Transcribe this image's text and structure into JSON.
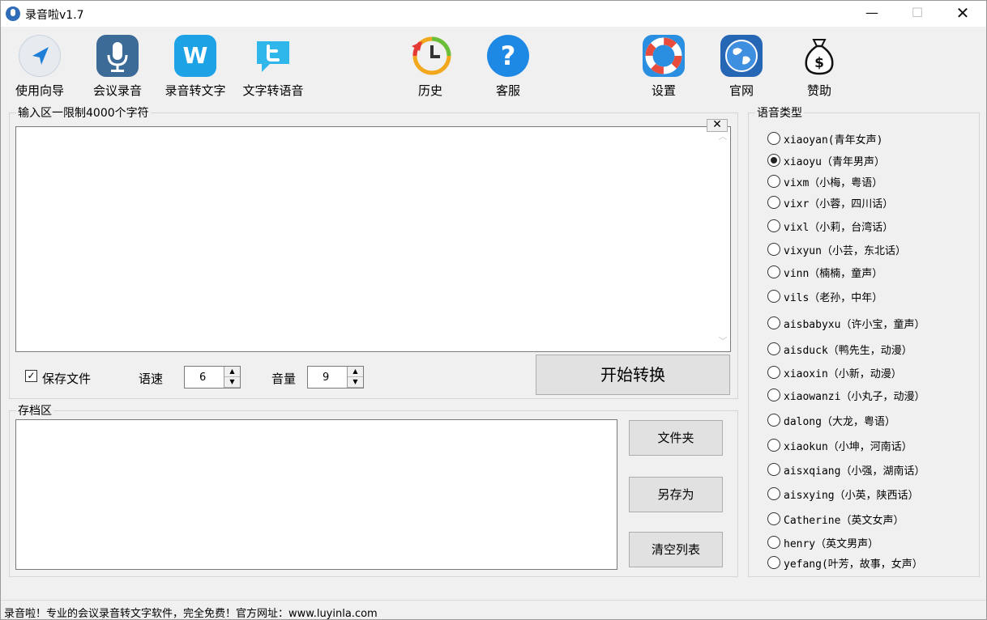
{
  "window": {
    "title": "录音啦v1.7",
    "controls": {
      "minimize": "—",
      "maximize": "☐",
      "close": "✕"
    }
  },
  "toolbar": [
    {
      "key": "guide",
      "label": "使用向导",
      "icon": "navigation-arrow-icon"
    },
    {
      "key": "meeting",
      "label": "会议录音",
      "icon": "microphone-icon"
    },
    {
      "key": "speech_to_text",
      "label": "录音转文字",
      "icon": "word-document-icon"
    },
    {
      "key": "text_to_speech",
      "label": "文字转语音",
      "icon": "bird-speech-icon"
    },
    {
      "key": "history",
      "label": "历史",
      "icon": "history-clock-icon"
    },
    {
      "key": "support",
      "label": "客服",
      "icon": "help-question-icon"
    },
    {
      "key": "settings",
      "label": "设置",
      "icon": "lifebuoy-icon"
    },
    {
      "key": "website",
      "label": "官网",
      "icon": "globe-icon"
    },
    {
      "key": "donate",
      "label": "赞助",
      "icon": "money-bag-icon"
    }
  ],
  "input_area": {
    "legend": "输入区一限制4000个字符",
    "text": "",
    "clear_button": "✕"
  },
  "options": {
    "save_file_label": "保存文件",
    "save_file_checked": true,
    "speed_label": "语速",
    "speed_value": "6",
    "volume_label": "音量",
    "volume_value": "9",
    "convert_button": "开始转换"
  },
  "archive_area": {
    "legend": "存档区",
    "items": [],
    "folder_button": "文件夹",
    "save_as_button": "另存为",
    "clear_list_button": "清空列表"
  },
  "voice_type": {
    "legend": "语音类型",
    "selected_index": 1,
    "options": [
      "xiaoyan(青年女声)",
      "xiaoyu（青年男声）",
      "vixm（小梅，粤语）",
      "vixr（小蓉，四川话）",
      "vixl（小莉，台湾话）",
      "vixyun（小芸，东北话）",
      "vinn（楠楠，童声）",
      "vils（老孙，中年）",
      "aisbabyxu（许小宝，童声）",
      "aisduck（鸭先生，动漫）",
      "xiaoxin（小新，动漫）",
      "xiaowanzi（小丸子，动漫）",
      "dalong（大龙，粤语）",
      "xiaokun（小坤，河南话）",
      "aisxqiang（小强，湖南话）",
      "aisxying（小英，陕西话）",
      "Catherine（英文女声）",
      "henry（英文男声）",
      "yefang(叶芳，故事，女声）"
    ]
  },
  "status_bar": {
    "text": "录音啦！专业的会议录音转文字软件，完全免费！官方网址：www.luyinla.com"
  }
}
